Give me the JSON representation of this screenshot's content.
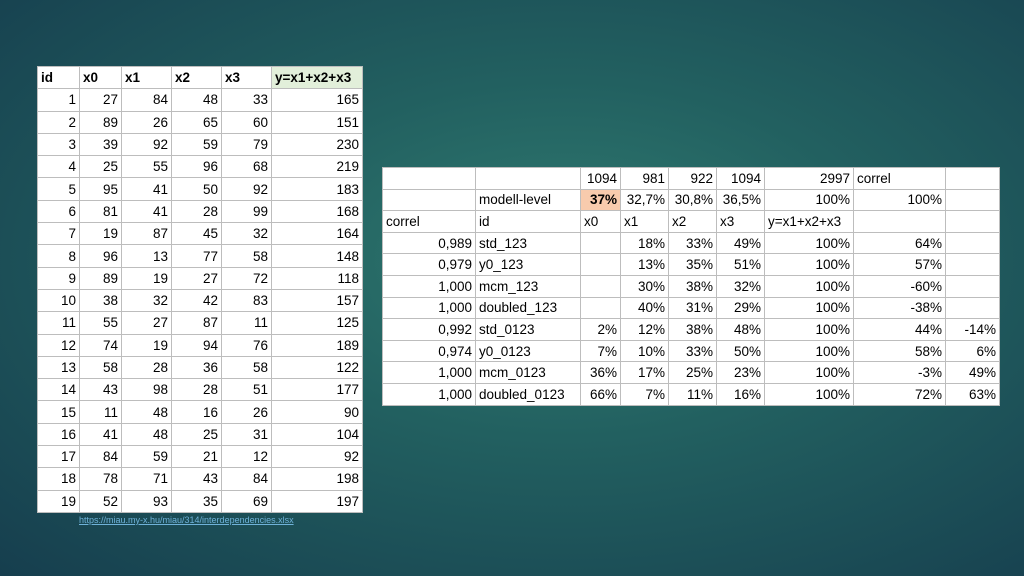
{
  "left_table": {
    "headers": [
      "id",
      "x0",
      "x1",
      "x2",
      "x3",
      "y=x1+x2+x3"
    ],
    "rows": [
      [
        "1",
        "27",
        "84",
        "48",
        "33",
        "165"
      ],
      [
        "2",
        "89",
        "26",
        "65",
        "60",
        "151"
      ],
      [
        "3",
        "39",
        "92",
        "59",
        "79",
        "230"
      ],
      [
        "4",
        "25",
        "55",
        "96",
        "68",
        "219"
      ],
      [
        "5",
        "95",
        "41",
        "50",
        "92",
        "183"
      ],
      [
        "6",
        "81",
        "41",
        "28",
        "99",
        "168"
      ],
      [
        "7",
        "19",
        "87",
        "45",
        "32",
        "164"
      ],
      [
        "8",
        "96",
        "13",
        "77",
        "58",
        "148"
      ],
      [
        "9",
        "89",
        "19",
        "27",
        "72",
        "118"
      ],
      [
        "10",
        "38",
        "32",
        "42",
        "83",
        "157"
      ],
      [
        "11",
        "55",
        "27",
        "87",
        "11",
        "125"
      ],
      [
        "12",
        "74",
        "19",
        "94",
        "76",
        "189"
      ],
      [
        "13",
        "58",
        "28",
        "36",
        "58",
        "122"
      ],
      [
        "14",
        "43",
        "98",
        "28",
        "51",
        "177"
      ],
      [
        "15",
        "11",
        "48",
        "16",
        "26",
        "90"
      ],
      [
        "16",
        "41",
        "48",
        "25",
        "31",
        "104"
      ],
      [
        "17",
        "84",
        "59",
        "21",
        "12",
        "92"
      ],
      [
        "18",
        "78",
        "71",
        "43",
        "84",
        "198"
      ],
      [
        "19",
        "52",
        "93",
        "35",
        "69",
        "197"
      ]
    ]
  },
  "right_table": {
    "row1": [
      "",
      "",
      "1094",
      "981",
      "922",
      "1094",
      "2997",
      "correl",
      ""
    ],
    "row2": [
      "",
      "modell-level",
      "37%",
      "32,7%",
      "30,8%",
      "36,5%",
      "100%",
      "100%",
      ""
    ],
    "row3": [
      "correl",
      "id",
      "x0",
      "x1",
      "x2",
      "x3",
      "y=x1+x2+x3",
      "",
      ""
    ],
    "rows": [
      [
        "0,989",
        "std_123",
        "",
        "18%",
        "33%",
        "49%",
        "100%",
        "64%",
        ""
      ],
      [
        "0,979",
        "y0_123",
        "",
        "13%",
        "35%",
        "51%",
        "100%",
        "57%",
        ""
      ],
      [
        "1,000",
        "mcm_123",
        "",
        "30%",
        "38%",
        "32%",
        "100%",
        "-60%",
        ""
      ],
      [
        "1,000",
        "doubled_123",
        "",
        "40%",
        "31%",
        "29%",
        "100%",
        "-38%",
        ""
      ],
      [
        "0,992",
        "std_0123",
        "2%",
        "12%",
        "38%",
        "48%",
        "100%",
        "44%",
        "-14%"
      ],
      [
        "0,974",
        "y0_0123",
        "7%",
        "10%",
        "33%",
        "50%",
        "100%",
        "58%",
        "6%"
      ],
      [
        "1,000",
        "mcm_0123",
        "36%",
        "17%",
        "25%",
        "23%",
        "100%",
        "-3%",
        "49%"
      ],
      [
        "1,000",
        "doubled_0123",
        "66%",
        "7%",
        "11%",
        "16%",
        "100%",
        "72%",
        "63%"
      ]
    ]
  },
  "source_link": "https://miau.my-x.hu/miau/314/interdependencies.xlsx",
  "colors": {
    "highlight": "#f8cbad",
    "y_header": "#e2efda"
  }
}
